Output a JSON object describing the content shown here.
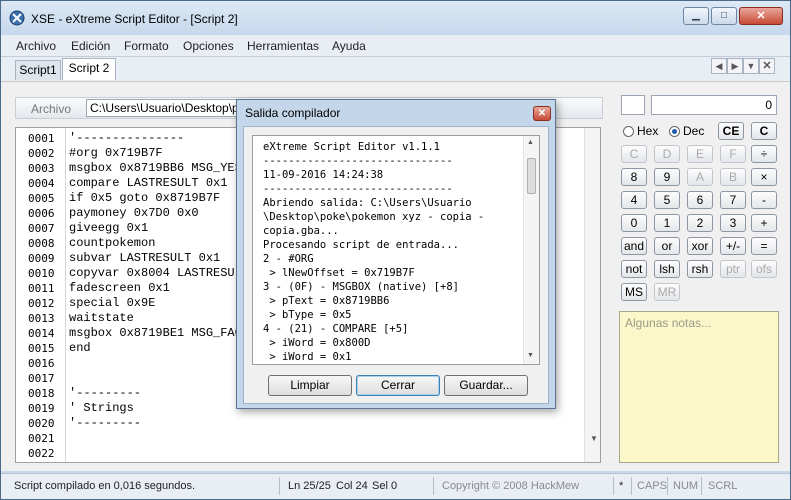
{
  "window": {
    "title": "XSE - eXtreme Script Editor - [Script 2]"
  },
  "menu": [
    "Archivo",
    "Edición",
    "Formato",
    "Opciones",
    "Herramientas",
    "Ayuda"
  ],
  "tabs": [
    "Script1",
    "Script 2"
  ],
  "toolbar": {
    "label": "Archivo",
    "path": "C:\\Users\\Usuario\\Desktop\\poke\\p"
  },
  "editor": {
    "lines": [
      {
        "num": "0001",
        "code": "'---------------"
      },
      {
        "num": "0002",
        "code": "#org 0x719B7F"
      },
      {
        "num": "0003",
        "code": "msgbox 0x8719BB6 MSG_YES"
      },
      {
        "num": "0004",
        "code": "compare LASTRESULT 0x1"
      },
      {
        "num": "0005",
        "code": "if 0x5 goto 0x8719B7F"
      },
      {
        "num": "0006",
        "code": "paymoney 0x7D0 0x0"
      },
      {
        "num": "0007",
        "code": "giveegg 0x1"
      },
      {
        "num": "0008",
        "code": "countpokemon"
      },
      {
        "num": "0009",
        "code": "subvar LASTRESULT 0x1"
      },
      {
        "num": "0010",
        "code": "copyvar 0x8004 LASTRESUL"
      },
      {
        "num": "0011",
        "code": "fadescreen 0x1"
      },
      {
        "num": "0012",
        "code": "special 0x9E"
      },
      {
        "num": "0013",
        "code": "waitstate"
      },
      {
        "num": "0014",
        "code": "msgbox 0x8719BE1 MSG_FAC"
      },
      {
        "num": "0015",
        "code": "end"
      },
      {
        "num": "0016",
        "code": ""
      },
      {
        "num": "0017",
        "code": ""
      },
      {
        "num": "0018",
        "code": "'---------"
      },
      {
        "num": "0019",
        "code": "' Strings"
      },
      {
        "num": "0020",
        "code": "'---------"
      },
      {
        "num": "0021",
        "code": ""
      },
      {
        "num": "0022",
        "code": ""
      }
    ]
  },
  "calculator": {
    "display": "0",
    "radios": [
      {
        "label": "Hex",
        "selected": false
      },
      {
        "label": "Dec",
        "selected": true
      }
    ],
    "clear_buttons": [
      "CE",
      "C"
    ],
    "rows": [
      [
        "C",
        "D",
        "E",
        "F",
        "÷"
      ],
      [
        "8",
        "9",
        "A",
        "B",
        "×"
      ],
      [
        "4",
        "5",
        "6",
        "7",
        "-"
      ],
      [
        "0",
        "1",
        "2",
        "3",
        "+"
      ],
      [
        "and",
        "or",
        "xor",
        "+/-",
        "="
      ],
      [
        "not",
        "lsh",
        "rsh",
        "ptr",
        "ofs"
      ],
      [
        "MS",
        "MR"
      ]
    ],
    "notes_placeholder": "Algunas notas..."
  },
  "status": {
    "message": "Script compilado en 0,016 segundos.",
    "position": "Ln 25/25",
    "column": "Col 24",
    "selection": "Sel 0",
    "copyright": "Copyright © 2008 HackMew",
    "modified": "*",
    "caps": "CAPS",
    "num": "NUM",
    "scrl": "SCRL"
  },
  "dialog": {
    "title": "Salida compilador",
    "log": [
      "eXtreme Script Editor v1.1.1",
      "------------------------------",
      "11-09-2016 14:24:38",
      "------------------------------",
      "Abriendo salida: C:\\Users\\Usuario",
      "\\Desktop\\poke\\pokemon xyz - copia -",
      "copia.gba...",
      "Procesando script de entrada...",
      "2 - #ORG",
      " > lNewOffset = 0x719B7F",
      "3 - (0F) - MSGBOX (native) [+8]",
      " > pText = 0x8719BB6",
      " > bType = 0x5",
      "4 - (21) - COMPARE [+5]",
      " > iWord = 0x800D",
      " > iWord = 0x1"
    ],
    "buttons": [
      "Limpiar",
      "Cerrar",
      "Guardar..."
    ]
  }
}
